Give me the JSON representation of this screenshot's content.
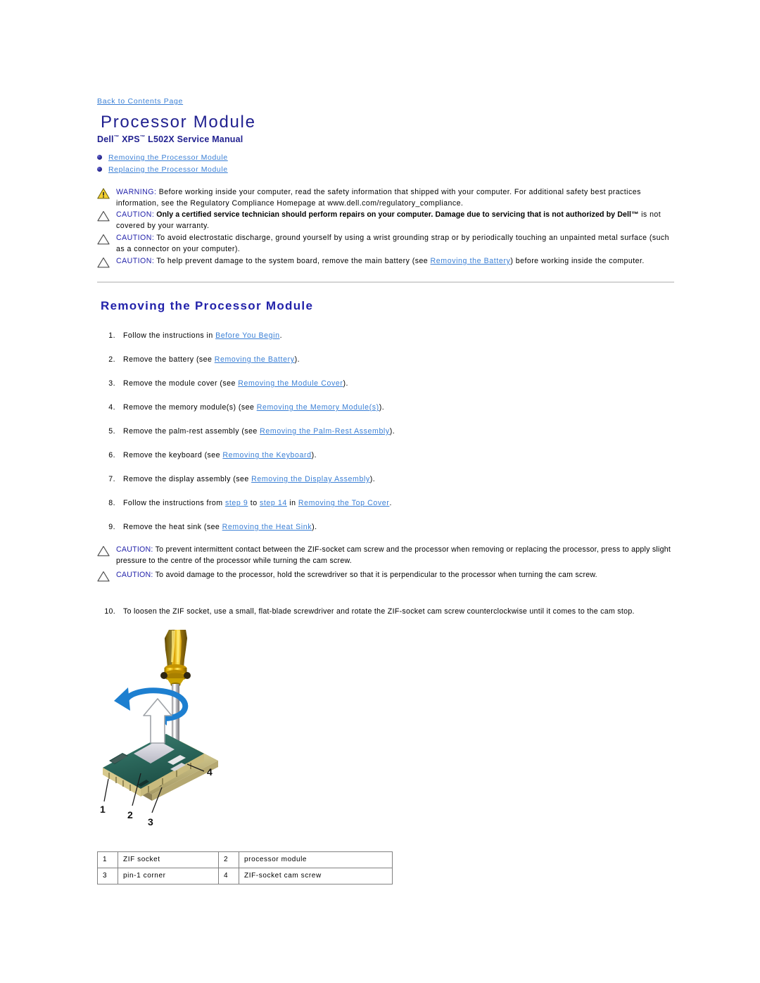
{
  "back_link": "Back to Contents Page",
  "title": "Processor Module",
  "subtitle_parts": {
    "a": "Dell",
    "b": "XPS",
    "c": "L502X Service Manual"
  },
  "toc": [
    {
      "label": "Removing the Processor Module"
    },
    {
      "label": "Replacing the Processor Module"
    }
  ],
  "notices": [
    {
      "icon": "warning-triangle-icon",
      "label": "WARNING:",
      "text": " Before working inside your computer, read the safety information that shipped with your computer. For additional safety best practices information, see the Regulatory Compliance Homepage at www.dell.com/regulatory_compliance."
    },
    {
      "icon": "caution-triangle-icon",
      "label": "CAUTION:",
      "bold_text": " Only a certified service technician should perform repairs on your computer. Damage due to servicing that is not authorized by Dell™",
      "text": " is not covered by your warranty."
    },
    {
      "icon": "caution-triangle-icon",
      "label": "CAUTION:",
      "text": " To avoid electrostatic discharge, ground yourself by using a wrist grounding strap or by periodically touching an unpainted metal surface (such as a connector on your computer)."
    },
    {
      "icon": "caution-triangle-icon",
      "label": "CAUTION:",
      "text_before": " To help prevent damage to the system board, remove the main battery (see ",
      "link": "Removing the Battery",
      "text_after": ") before working inside the computer."
    }
  ],
  "section_heading": "Removing the Processor Module",
  "steps": [
    {
      "num": "1.",
      "before": "Follow the instructions in ",
      "link": "Before You Begin",
      "after": "."
    },
    {
      "num": "2.",
      "before": "Remove the battery (see ",
      "link": "Removing the Battery",
      "after": ")."
    },
    {
      "num": "3.",
      "before": "Remove the module cover (see ",
      "link": "Removing the Module Cover",
      "after": ")."
    },
    {
      "num": "4.",
      "before": "Remove the memory module(s) (see ",
      "link": "Removing the Memory Module(s)",
      "after": ")."
    },
    {
      "num": "5.",
      "before": "Remove the palm-rest assembly (see ",
      "link": "Removing the Palm-Rest Assembly",
      "after": ")."
    },
    {
      "num": "6.",
      "before": "Remove the keyboard (see ",
      "link": "Removing the Keyboard",
      "after": ")."
    },
    {
      "num": "7.",
      "before": "Remove the display assembly (see ",
      "link": "Removing the Display Assembly",
      "after": ")."
    },
    {
      "num": "8.",
      "before": "Follow the instructions from ",
      "link": "step 9",
      "mid": " to ",
      "link2": "step 14",
      "mid2": " in ",
      "link3": "Removing the Top Cover",
      "after": "."
    },
    {
      "num": "9.",
      "before": "Remove the heat sink (see ",
      "link": "Removing the Heat Sink",
      "after": ")."
    }
  ],
  "notices2": [
    {
      "icon": "caution-triangle-icon",
      "label": "CAUTION:",
      "text": " To prevent intermittent contact between the ZIF-socket cam screw and the processor when removing or replacing the processor, press to apply slight pressure to the centre of the processor while turning the cam screw."
    },
    {
      "icon": "caution-triangle-icon",
      "label": "CAUTION:",
      "text": " To avoid damage to the processor, hold the screwdriver so that it is perpendicular to the processor when turning the cam screw."
    }
  ],
  "step10": {
    "num": "10.",
    "text": "To loosen the ZIF socket, use a small, flat-blade screwdriver and rotate the ZIF-socket cam screw counterclockwise until it comes to the cam stop."
  },
  "figure": {
    "callouts": [
      "1",
      "2",
      "3",
      "4"
    ]
  },
  "legend": {
    "rows": [
      {
        "n1": "1",
        "d1": "ZIF socket",
        "n2": "2",
        "d2": "processor module"
      },
      {
        "n1": "3",
        "d1": "pin-1 corner",
        "n2": "4",
        "d2": "ZIF-socket cam screw"
      }
    ]
  },
  "colors": {
    "title_blue": "#1f1f8f",
    "heading_blue": "#2222aa",
    "link_blue": "#3a7fd5",
    "warning_yellow": "#f5d130",
    "rule_gray": "#d4d4d4"
  }
}
